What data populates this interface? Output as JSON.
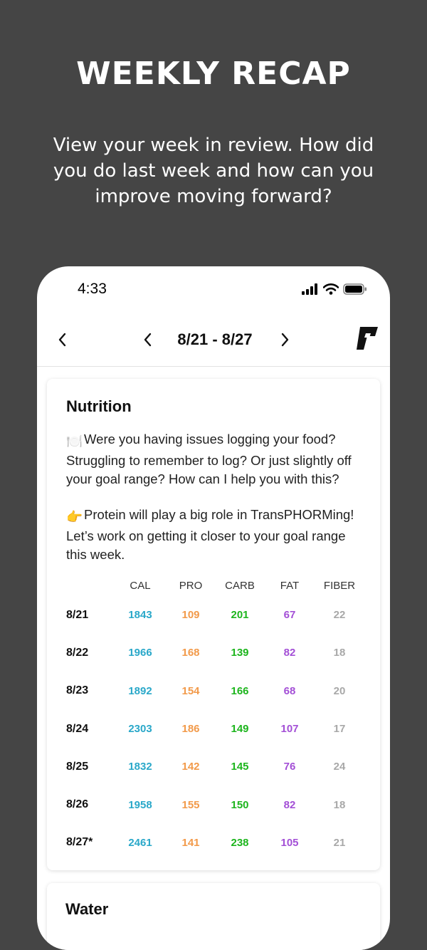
{
  "hero": {
    "title": "WEEKLY RECAP",
    "subtitle": "View your week in review. How did you do last week and how can you improve moving forward?"
  },
  "status_bar": {
    "time": "4:33",
    "icons": [
      "cellular-signal-icon",
      "wifi-icon",
      "battery-icon"
    ]
  },
  "nav": {
    "back_icon": "chevron-left-icon",
    "prev_icon": "chevron-left-icon",
    "next_icon": "chevron-right-icon",
    "date_range": "8/21 - 8/27",
    "logo_icon": "brand-logo-icon"
  },
  "nutrition": {
    "title": "Nutrition",
    "paragraph1_emoji": "🍽️",
    "paragraph1": "Were you having issues logging your food? Struggling to remember to log? Or just slightly off your goal range? How can I help you with this?",
    "paragraph2_emoji": "👉",
    "paragraph2": "Protein will play a big role in TransPHORMing! Let’s work on getting it closer to your goal range this week.",
    "columns": [
      "",
      "CAL",
      "PRO",
      "CARB",
      "FAT",
      "FIBER"
    ],
    "rows": [
      {
        "date": "8/21",
        "cal": "1843",
        "pro": "109",
        "carb": "201",
        "fat": "67",
        "fiber": "22"
      },
      {
        "date": "8/22",
        "cal": "1966",
        "pro": "168",
        "carb": "139",
        "fat": "82",
        "fiber": "18"
      },
      {
        "date": "8/23",
        "cal": "1892",
        "pro": "154",
        "carb": "166",
        "fat": "68",
        "fiber": "20"
      },
      {
        "date": "8/24",
        "cal": "2303",
        "pro": "186",
        "carb": "149",
        "fat": "107",
        "fiber": "17"
      },
      {
        "date": "8/25",
        "cal": "1832",
        "pro": "142",
        "carb": "145",
        "fat": "76",
        "fiber": "24"
      },
      {
        "date": "8/26",
        "cal": "1958",
        "pro": "155",
        "carb": "150",
        "fat": "82",
        "fiber": "18"
      },
      {
        "date": "8/27*",
        "cal": "2461",
        "pro": "141",
        "carb": "238",
        "fat": "105",
        "fiber": "21"
      }
    ],
    "colors": {
      "cal": "#2aa8c9",
      "pro": "#f29a4a",
      "carb": "#1db51d",
      "fat": "#a34fd6",
      "fiber": "#a8a8a8"
    }
  },
  "water": {
    "title": "Water"
  },
  "colors": {
    "background": "#454545",
    "phone": "#ffffff"
  }
}
